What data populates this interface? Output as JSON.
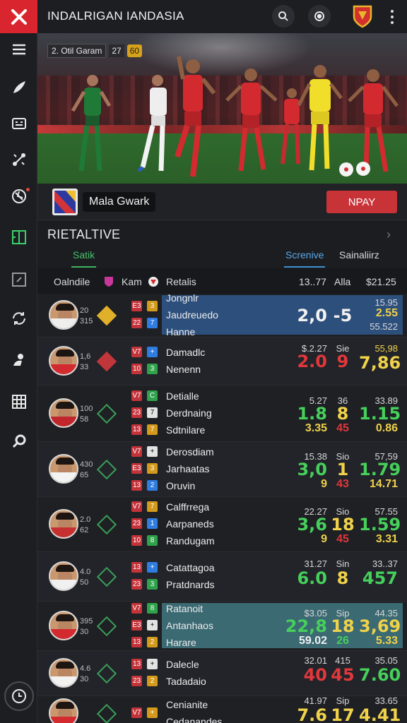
{
  "app": {
    "title": "INDALRIGAN IANDASIA"
  },
  "hero": {
    "badge_text": "2. Otil Garam",
    "badge_num": "27",
    "badge_num2": "60"
  },
  "team": {
    "name": "Mala Gwark",
    "button_label": "NPAY"
  },
  "section": {
    "title": "RIETALTIVE",
    "tabs": [
      "Satik",
      "Screnive",
      "Sainaliirz"
    ]
  },
  "columns": [
    "Oalndile",
    "Kam",
    "Retalis",
    "13..77",
    "Alla",
    "$21.25"
  ],
  "rows": [
    {
      "s1": "20",
      "s2": "315",
      "badges": [
        "E3",
        "22"
      ],
      "b2": [
        "3",
        "7"
      ],
      "names": [
        "Jongnlr",
        "Jaudreuedo",
        "Hanne"
      ],
      "a": [
        "",
        "",
        ""
      ],
      "big1": "2,0",
      "big2": "-5",
      "c": [
        "15.95",
        "2.55",
        "55.522"
      ]
    },
    {
      "s1": "1,6",
      "s2": "33",
      "badges": [
        "V7",
        "10"
      ],
      "b2": [
        "+",
        "3"
      ],
      "names": [
        "Damadlc",
        "Nenenn"
      ],
      "a": [
        "$.2.27",
        "Sie",
        "55,98"
      ],
      "big1": "2.0",
      "big2": "9",
      "c": [
        "7,86"
      ]
    },
    {
      "s1": "100",
      "s2": "58",
      "badges": [
        "V7",
        "23",
        "13"
      ],
      "b2": [
        "C",
        "7",
        "7"
      ],
      "names": [
        "Detialle",
        "Derdnaing",
        "Sdtnilare"
      ],
      "a": [
        "5.27",
        "36",
        "33.89"
      ],
      "v1": [
        "1.8",
        "8",
        "1.15"
      ],
      "v2": [
        "3.35",
        "45",
        "0.86"
      ]
    },
    {
      "s1": "430",
      "s2": "65",
      "badges": [
        "V7",
        "E3",
        "13"
      ],
      "b2": [
        "+",
        "3",
        "2"
      ],
      "names": [
        "Derosdiam",
        "Jarhaatas",
        "Oruvin"
      ],
      "a": [
        "15.38",
        "Sio",
        "57,59"
      ],
      "v1": [
        "3,0",
        "1",
        "1.79"
      ],
      "v2": [
        "9",
        "43",
        "14.71"
      ]
    },
    {
      "s1": "2.0",
      "s2": "62",
      "badges": [
        "V7",
        "23",
        "10"
      ],
      "b2": [
        "7",
        "1",
        "8"
      ],
      "names": [
        "Calffrrega",
        "Aarpaneds",
        "Randugam"
      ],
      "a": [
        "22.27",
        "Sio",
        "57.55"
      ],
      "v1": [
        "3,6",
        "18",
        "1.59"
      ],
      "v2": [
        "9",
        "45",
        "3.31"
      ]
    },
    {
      "s1": "4.0",
      "s2": "50",
      "badges": [
        "13",
        "23"
      ],
      "b2": [
        "+",
        "3"
      ],
      "names": [
        "Catattagoa",
        "Pratdnards"
      ],
      "a": [
        "31.27",
        "Sin",
        "33..37"
      ],
      "v1": [
        "6.0",
        "8",
        "457"
      ]
    },
    {
      "s1": "395",
      "s2": "30",
      "badges": [
        "V7",
        "E3",
        "13"
      ],
      "b2": [
        "8",
        "+",
        "2"
      ],
      "names": [
        "Ratanoit",
        "Antanhaos",
        "Harare"
      ],
      "a": [
        "$3.05",
        "Sip",
        "44.35"
      ],
      "v1": [
        "22,8",
        "18",
        "3,69"
      ],
      "v2": [
        "59.02",
        "26",
        "5.33"
      ]
    },
    {
      "s1": "4.6",
      "s2": "30",
      "badges": [
        "13",
        "23"
      ],
      "b2": [
        "+",
        "2"
      ],
      "names": [
        "Dalecle",
        "Tadadaio"
      ],
      "a": [
        "32.01",
        "415",
        "35.05"
      ],
      "v1": [
        "40",
        "45",
        "7.60"
      ]
    },
    {
      "s1": "",
      "s2": "",
      "badges": [
        "V7"
      ],
      "b2": [
        "+"
      ],
      "names": [
        "Cenianite",
        "Cedanandes"
      ],
      "a": [
        "41.97",
        "Sip",
        "33.65"
      ],
      "v1": [
        "7.6",
        "17",
        "4.41"
      ]
    }
  ]
}
